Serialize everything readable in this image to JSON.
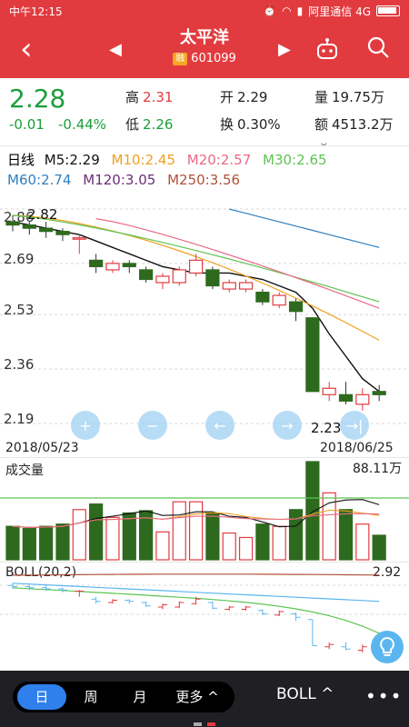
{
  "status": {
    "time": "中午12:15",
    "carrier": "阿里通信 4G"
  },
  "nav": {
    "name": "太平洋",
    "badge": "融",
    "code": "601099"
  },
  "quote": {
    "price": "2.28",
    "change": "-0.01",
    "change_pct": "-0.44%",
    "high_label": "高",
    "high": "2.31",
    "low_label": "低",
    "low": "2.26",
    "open_label": "开",
    "open": "2.29",
    "turnover_label": "换",
    "turnover": "0.30%",
    "volume_label": "量",
    "volume": "19.75万",
    "amount_label": "额",
    "amount": "4513.2万"
  },
  "ma": {
    "period": "日线",
    "m5": "M5:2.29",
    "m10": "M10:2.45",
    "m20": "M20:2.57",
    "m30": "M30:2.65",
    "m60": "M60:2.74",
    "m120": "M120:3.05",
    "m250": "M250:3.56"
  },
  "colors": {
    "red": "#e23b3f",
    "green": "#1a9e3a",
    "m5": "#111111",
    "m10": "#f0a020",
    "m20": "#e96a86",
    "m30": "#5cc451",
    "m60": "#2e7fc1",
    "m120": "#6b2d7a",
    "m250": "#b0503a"
  },
  "chart_data": {
    "type": "candlestick",
    "y_ticks": [
      "2.86",
      "2.69",
      "2.53",
      "2.36",
      "2.19"
    ],
    "ylim": [
      2.19,
      2.86
    ],
    "x_start": "2018/05/23",
    "x_end": "2018/06/25",
    "high_annotation": "2.82",
    "low_annotation": "2.23",
    "candles": [
      {
        "o": 2.82,
        "h": 2.84,
        "l": 2.79,
        "c": 2.81
      },
      {
        "o": 2.81,
        "h": 2.82,
        "l": 2.78,
        "c": 2.8
      },
      {
        "o": 2.8,
        "h": 2.82,
        "l": 2.77,
        "c": 2.79
      },
      {
        "o": 2.79,
        "h": 2.8,
        "l": 2.76,
        "c": 2.78
      },
      {
        "o": 2.77,
        "h": 2.78,
        "l": 2.72,
        "c": 2.77
      },
      {
        "o": 2.7,
        "h": 2.72,
        "l": 2.66,
        "c": 2.68
      },
      {
        "o": 2.67,
        "h": 2.7,
        "l": 2.66,
        "c": 2.69
      },
      {
        "o": 2.69,
        "h": 2.7,
        "l": 2.66,
        "c": 2.68
      },
      {
        "o": 2.67,
        "h": 2.68,
        "l": 2.63,
        "c": 2.64
      },
      {
        "o": 2.63,
        "h": 2.66,
        "l": 2.61,
        "c": 2.65
      },
      {
        "o": 2.63,
        "h": 2.68,
        "l": 2.62,
        "c": 2.67
      },
      {
        "o": 2.66,
        "h": 2.72,
        "l": 2.65,
        "c": 2.7
      },
      {
        "o": 2.67,
        "h": 2.68,
        "l": 2.61,
        "c": 2.62
      },
      {
        "o": 2.61,
        "h": 2.64,
        "l": 2.6,
        "c": 2.63
      },
      {
        "o": 2.61,
        "h": 2.64,
        "l": 2.6,
        "c": 2.63
      },
      {
        "o": 2.6,
        "h": 2.61,
        "l": 2.56,
        "c": 2.57
      },
      {
        "o": 2.56,
        "h": 2.6,
        "l": 2.55,
        "c": 2.59
      },
      {
        "o": 2.57,
        "h": 2.58,
        "l": 2.51,
        "c": 2.54
      },
      {
        "o": 2.52,
        "h": 2.52,
        "l": 2.29,
        "c": 2.29
      },
      {
        "o": 2.28,
        "h": 2.32,
        "l": 2.26,
        "c": 2.3
      },
      {
        "o": 2.28,
        "h": 2.32,
        "l": 2.25,
        "c": 2.26
      },
      {
        "o": 2.25,
        "h": 2.3,
        "l": 2.23,
        "c": 2.28
      },
      {
        "o": 2.29,
        "h": 2.31,
        "l": 2.26,
        "c": 2.28
      }
    ],
    "ma5": [
      2.82,
      2.81,
      2.8,
      2.79,
      2.78,
      2.76,
      2.74,
      2.72,
      2.7,
      2.68,
      2.67,
      2.66,
      2.66,
      2.66,
      2.65,
      2.64,
      2.62,
      2.6,
      2.55,
      2.47,
      2.4,
      2.33,
      2.29
    ],
    "volume": {
      "label": "成交量",
      "max": "88.11万",
      "bars": [
        30,
        28,
        30,
        32,
        45,
        50,
        38,
        42,
        44,
        25,
        52,
        52,
        42,
        24,
        20,
        32,
        30,
        45,
        88,
        60,
        45,
        32,
        22
      ]
    },
    "boll": {
      "label": "BOLL(20,2)",
      "value": "2.92"
    }
  },
  "period_tabs": [
    {
      "label": "日",
      "active": true
    },
    {
      "label": "周",
      "active": false
    },
    {
      "label": "月",
      "active": false
    },
    {
      "label": "更多 ^",
      "active": false
    }
  ],
  "bottom": {
    "indicator": "BOLL ^",
    "more": "•••"
  }
}
